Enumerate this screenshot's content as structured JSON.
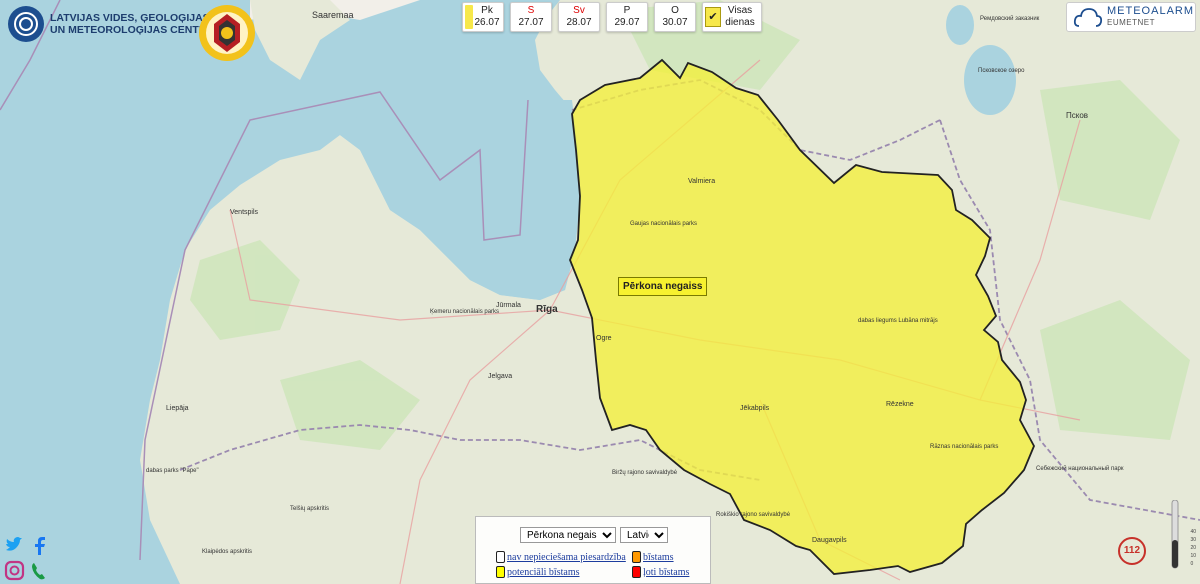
{
  "header": {
    "org_line1": "LATVIJAS VIDES, ĢEOLOĢIJAS",
    "org_line2": "UN METEOROLOĢIJAS CENTRS"
  },
  "days": [
    {
      "name": "Pk",
      "date": "26.07",
      "weekend": false,
      "has_warning": true
    },
    {
      "name": "S",
      "date": "27.07",
      "weekend": true,
      "has_warning": false
    },
    {
      "name": "Sv",
      "date": "28.07",
      "weekend": true,
      "has_warning": false
    },
    {
      "name": "P",
      "date": "29.07",
      "weekend": false,
      "has_warning": false
    },
    {
      "name": "O",
      "date": "30.07",
      "weekend": false,
      "has_warning": false
    }
  ],
  "all_days": {
    "line1": "Visas",
    "line2": "dienas",
    "checked": true
  },
  "meteoalarm": {
    "title": "METEOALARM",
    "subtitle": "EUMETNET"
  },
  "warning": {
    "label": "Pērkona negaiss",
    "level_color": "#f4f03a"
  },
  "map_labels": {
    "saaremaa": "Saaremaa",
    "ventspils": "Ventspils",
    "riga": "Rīga",
    "jurmala": "Jūrmala",
    "kemeru": "Ķemeru nacionālais parks",
    "jelgava": "Jelgava",
    "liepaja": "Liepāja",
    "ogre": "Ogre",
    "valmiera": "Valmiera",
    "gaujas": "Gaujas nacionālais parks",
    "jekabpils": "Jēkabpils",
    "rezekne": "Rēzekne",
    "daugavpils": "Daugavpils",
    "pskov": "Псков",
    "pskov_lake": "Псковское озеро",
    "remdovsky": "Ремдовский заказник",
    "sebezh": "Себежский национальный парк",
    "papes": "dabas parks \"Pape\"",
    "telsiu": "Telšių apskritis",
    "klaipeda": "Klaipėdos apskritis",
    "birzu": "Biržų rajono savivaldybė",
    "rokiskio": "Rokiškio rajono savivaldybė",
    "razna": "Rāznas nacionālais parks",
    "lubana": "dabas liegums Lubāna mitrājs"
  },
  "legend": {
    "hazard_select": "Pērkona negaiss",
    "hazard_options": [
      "Pērkona negaiss"
    ],
    "language_select": "Latviešu",
    "language_options": [
      "Latviešu"
    ],
    "items": [
      {
        "label": "nav nepieciešama piesardzība",
        "color": "#ffffff"
      },
      {
        "label": "bīstams",
        "color": "#ff9900"
      },
      {
        "label": "potenciāli bīstams",
        "color": "#ffff00"
      },
      {
        "label": "ļoti bīstams",
        "color": "#ff0000"
      }
    ]
  },
  "social": {
    "twitter": "twitter-icon",
    "facebook": "facebook-icon",
    "instagram": "instagram-icon",
    "phone": "phone-icon"
  },
  "sos": {
    "label": "112"
  },
  "zoom_scale": {
    "ticks": [
      "40",
      "30",
      "20",
      "10",
      "0"
    ]
  }
}
